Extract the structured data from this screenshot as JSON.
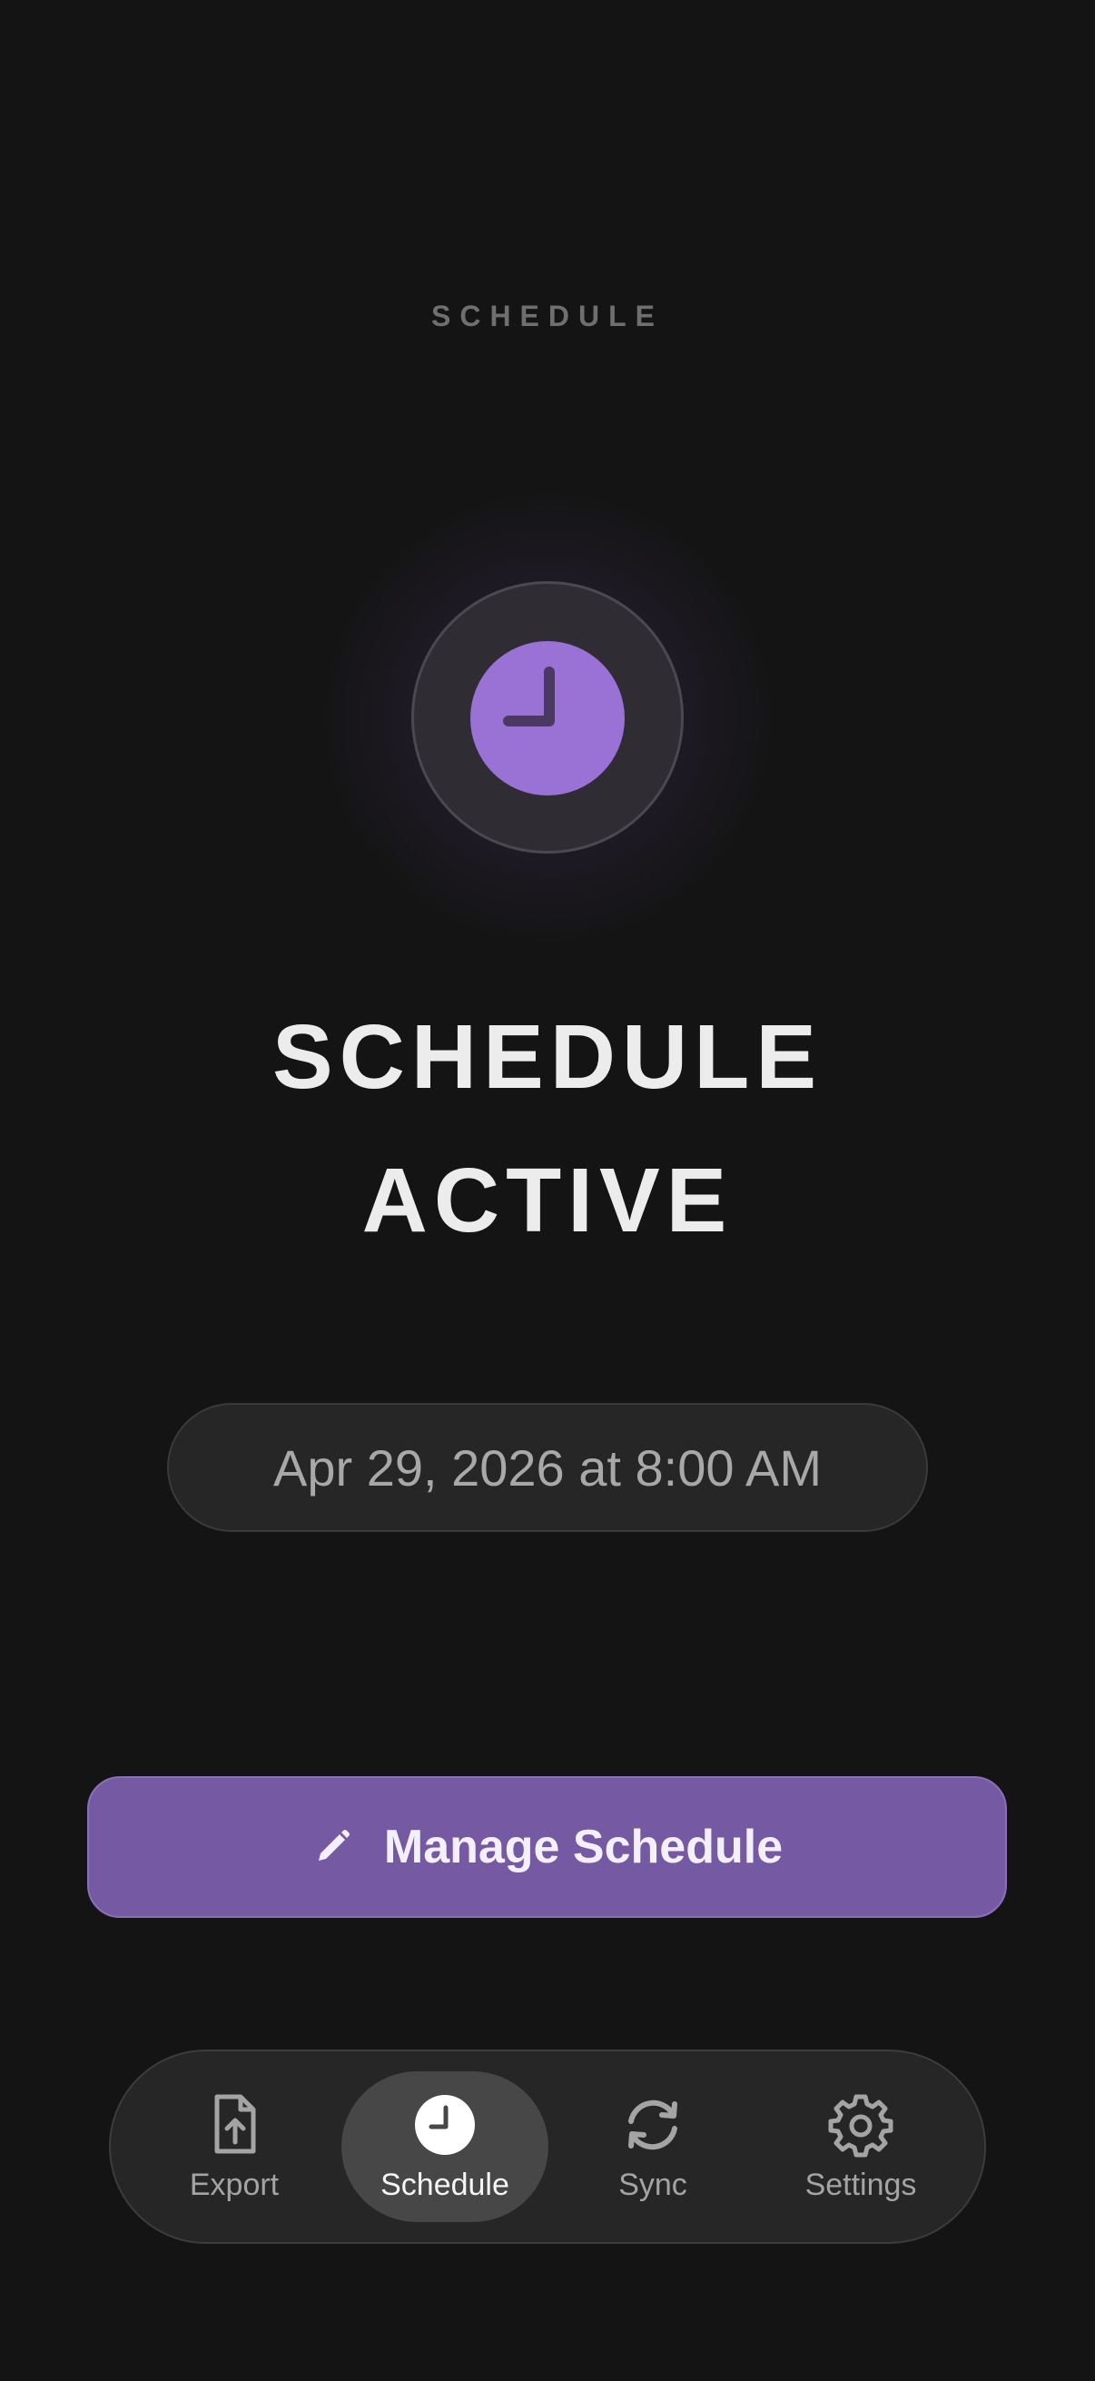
{
  "header": {
    "label": "SCHEDULE"
  },
  "status": {
    "title_line1": "SCHEDULE",
    "title_line2": "ACTIVE",
    "scheduled_time": "Apr 29, 2026 at 8:00 AM"
  },
  "actions": {
    "manage_label": "Manage Schedule",
    "manage_icon": "pencil-icon"
  },
  "tabbar": {
    "active": "schedule",
    "tabs": [
      {
        "id": "export",
        "label": "Export",
        "icon": "file-upload-icon"
      },
      {
        "id": "schedule",
        "label": "Schedule",
        "icon": "clock-icon"
      },
      {
        "id": "sync",
        "label": "Sync",
        "icon": "sync-icon"
      },
      {
        "id": "settings",
        "label": "Settings",
        "icon": "gear-icon"
      }
    ]
  },
  "colors": {
    "background": "#141414",
    "accent": "#9a72d6",
    "button": "#7559a3",
    "muted_text": "#a8a8a8"
  }
}
